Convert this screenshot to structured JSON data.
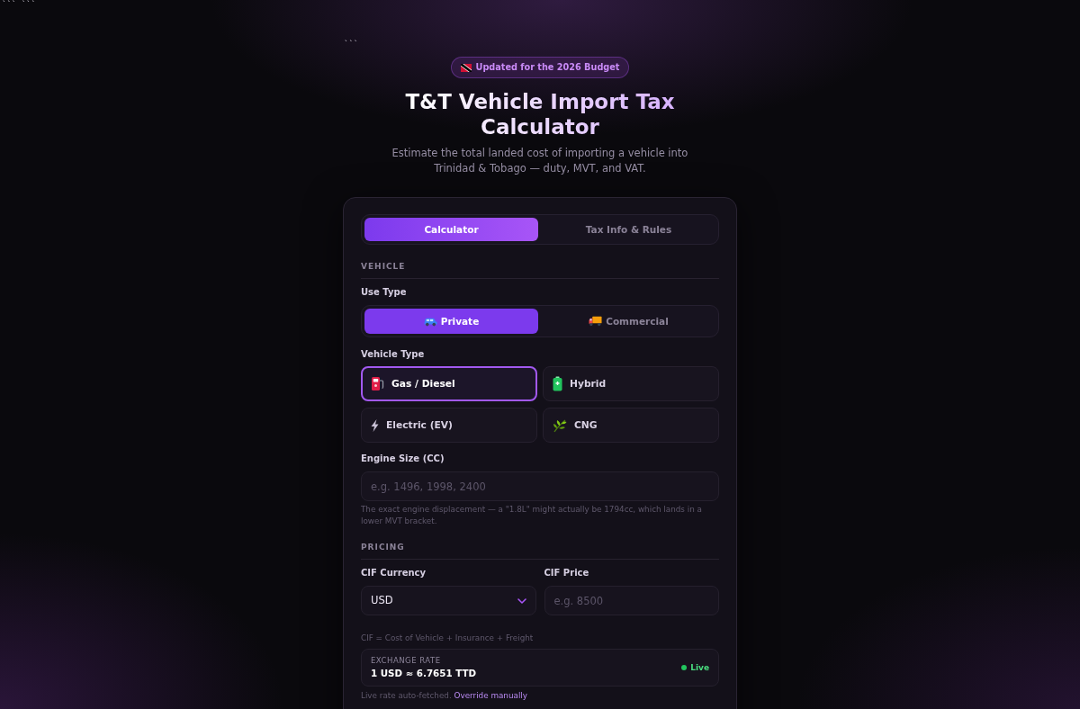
{
  "stray_text": [
    "``` ```",
    "```"
  ],
  "badge": {
    "text": "Updated for the 2026 Budget"
  },
  "header": {
    "title": "T&T Vehicle Import Tax Calculator",
    "subtitle": "Estimate the total landed cost of importing a vehicle into Trinidad & Tobago — duty, MVT, and VAT."
  },
  "tabs": [
    {
      "label": "Calculator",
      "selected": true
    },
    {
      "label": "Tax Info & Rules",
      "selected": false
    }
  ],
  "vehicle": {
    "heading": "VEHICLE",
    "use_type": {
      "label": "Use Type",
      "options": [
        {
          "label": "Private",
          "selected": true
        },
        {
          "label": "Commercial",
          "selected": false
        }
      ]
    },
    "vehicle_type": {
      "label": "Vehicle Type",
      "options": [
        {
          "label": "Gas / Diesel",
          "selected": true
        },
        {
          "label": "Hybrid",
          "selected": false
        },
        {
          "label": "Electric (EV)",
          "selected": false
        },
        {
          "label": "CNG",
          "selected": false
        }
      ]
    },
    "engine_size": {
      "label": "Engine Size (CC)",
      "placeholder": "e.g. 1496, 1998, 2400",
      "hint": "The exact engine displacement — a \"1.8L\" might actually be 1794cc, which lands in a lower MVT bracket."
    }
  },
  "pricing": {
    "heading": "PRICING",
    "currency": {
      "label": "CIF Currency",
      "value": "USD"
    },
    "price": {
      "label": "CIF Price",
      "placeholder": "e.g. 8500"
    },
    "hint": "CIF = Cost of Vehicle + Insurance + Freight",
    "exchange_rate": {
      "label": "EXCHANGE RATE",
      "value": "1 USD ≈ 6.7651 TTD",
      "status": "Live"
    },
    "note": "Live rate auto-fetched.",
    "link": "Override manually"
  }
}
